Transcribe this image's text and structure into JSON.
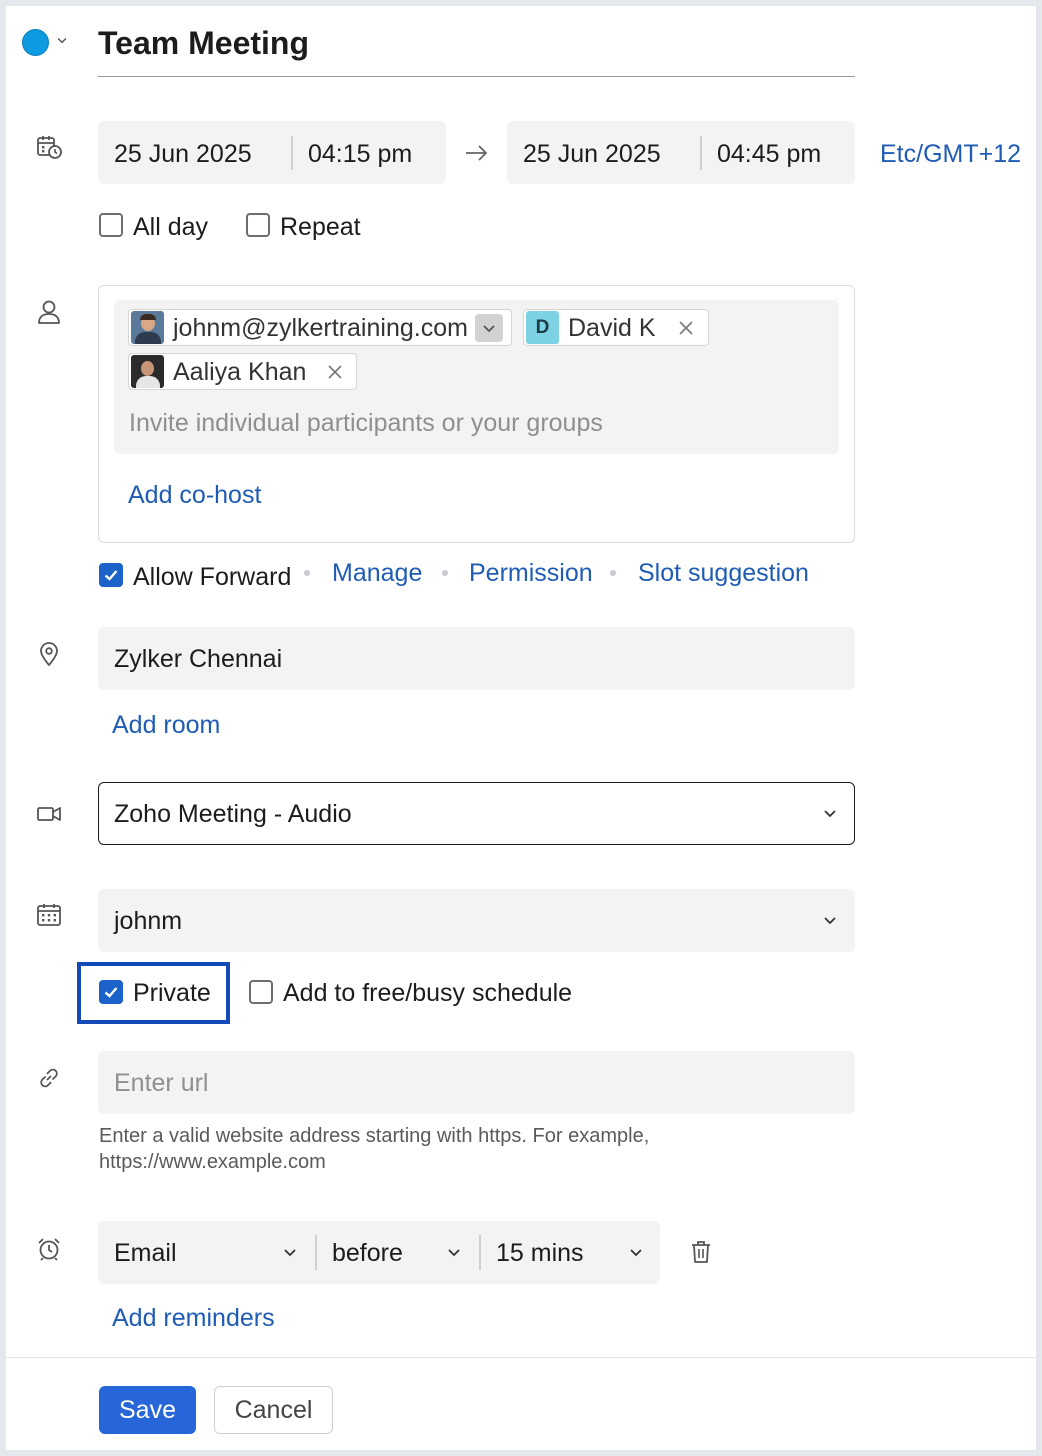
{
  "event": {
    "title": "Team Meeting",
    "color": "#0e9ae0"
  },
  "datetime": {
    "start_date": "25 Jun 2025",
    "start_time": "04:15 pm",
    "end_date": "25 Jun 2025",
    "end_time": "04:45 pm",
    "timezone": "Etc/GMT+12",
    "all_day_label": "All day",
    "repeat_label": "Repeat"
  },
  "participants": {
    "organizer_email": "johnm@zylkertraining.com",
    "chips": [
      {
        "initial": "D",
        "name": "David K"
      },
      {
        "name": "Aaliya Khan"
      }
    ],
    "invite_placeholder": "Invite individual participants or your groups",
    "add_cohost_label": "Add co-host",
    "allow_forward_label": "Allow Forward",
    "manage_label": "Manage",
    "permission_label": "Permission",
    "slot_suggestion_label": "Slot suggestion"
  },
  "location": {
    "value": "Zylker Chennai",
    "add_room_label": "Add room"
  },
  "meeting": {
    "provider": "Zoho Meeting - Audio"
  },
  "calendar": {
    "value": "johnm",
    "private_label": "Private",
    "freebusy_label": "Add to free/busy schedule"
  },
  "url": {
    "placeholder": "Enter url",
    "hint": "Enter a valid website address starting with https. For example, https://www.example.com"
  },
  "reminder": {
    "type": "Email",
    "when": "before",
    "duration": "15 mins",
    "add_label": "Add reminders"
  },
  "actions": {
    "save_label": "Save",
    "cancel_label": "Cancel"
  },
  "colors": {
    "accent": "#2766d9",
    "link": "#1f5cb5",
    "highlight_border": "#1449b8"
  }
}
